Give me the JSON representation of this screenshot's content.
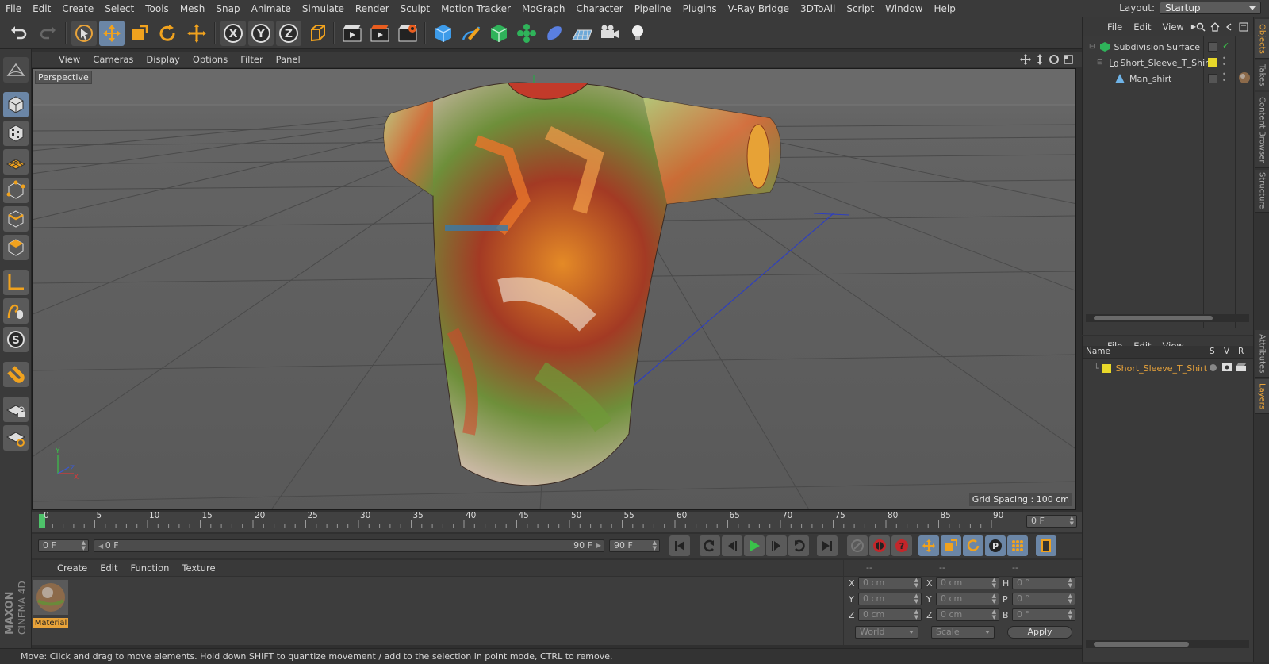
{
  "menu": [
    "File",
    "Edit",
    "Create",
    "Select",
    "Tools",
    "Mesh",
    "Snap",
    "Animate",
    "Simulate",
    "Render",
    "Sculpt",
    "Motion Tracker",
    "MoGraph",
    "Character",
    "Pipeline",
    "Plugins",
    "V-Ray Bridge",
    "3DToAll",
    "Script",
    "Window",
    "Help"
  ],
  "layout": {
    "label": "Layout:",
    "value": "Startup"
  },
  "toolbar": {
    "x": "X",
    "y": "Y",
    "z": "Z"
  },
  "viewport": {
    "menu": [
      "View",
      "Cameras",
      "Display",
      "Options",
      "Filter",
      "Panel"
    ],
    "camera": "Perspective",
    "grid_spacing": "Grid Spacing : 100 cm",
    "axis_y": "Y",
    "axis_z": "Z",
    "axis_x": "X"
  },
  "timeline": {
    "ticks": [
      "0",
      "5",
      "10",
      "15",
      "20",
      "25",
      "30",
      "35",
      "40",
      "45",
      "50",
      "55",
      "60",
      "65",
      "70",
      "75",
      "80",
      "85",
      "90"
    ],
    "current": "0 F"
  },
  "transport": {
    "start": "0 F",
    "range_start": "0 F",
    "range_end": "90 F",
    "end": "90 F",
    "p_label": "P"
  },
  "material": {
    "menu": [
      "Create",
      "Edit",
      "Function",
      "Texture"
    ],
    "item": "Material"
  },
  "coords": {
    "head1": "--",
    "head2": "--",
    "head3": "--",
    "rows": [
      {
        "a": "X",
        "av": "0 cm",
        "b": "X",
        "bv": "0 cm",
        "c": "H",
        "cv": "0 °"
      },
      {
        "a": "Y",
        "av": "0 cm",
        "b": "Y",
        "bv": "0 cm",
        "c": "P",
        "cv": "0 °"
      },
      {
        "a": "Z",
        "av": "0 cm",
        "b": "Z",
        "bv": "0 cm",
        "c": "B",
        "cv": "0 °"
      }
    ],
    "space": "World",
    "mode": "Scale",
    "apply": "Apply"
  },
  "status": "Move: Click and drag to move elements. Hold down SHIFT to quantize movement / add to the selection in point mode, CTRL to remove.",
  "objects": {
    "menu": [
      "File",
      "Edit",
      "View"
    ],
    "items": [
      "Subdivision Surface",
      "Short_Sleeve_T_Shirt",
      "Man_shirt"
    ]
  },
  "layers": {
    "menu": [
      "File",
      "Edit",
      "View"
    ],
    "col_name": "Name",
    "col_s": "S",
    "col_v": "V",
    "col_r": "R",
    "item": "Short_Sleeve_T_Shirt"
  },
  "side_tabs": [
    "Objects",
    "Takes",
    "Content Browser",
    "Structure",
    "Attributes",
    "Layers"
  ],
  "brand": {
    "maxon": "MAXON",
    "c4d": "CINEMA 4D"
  }
}
